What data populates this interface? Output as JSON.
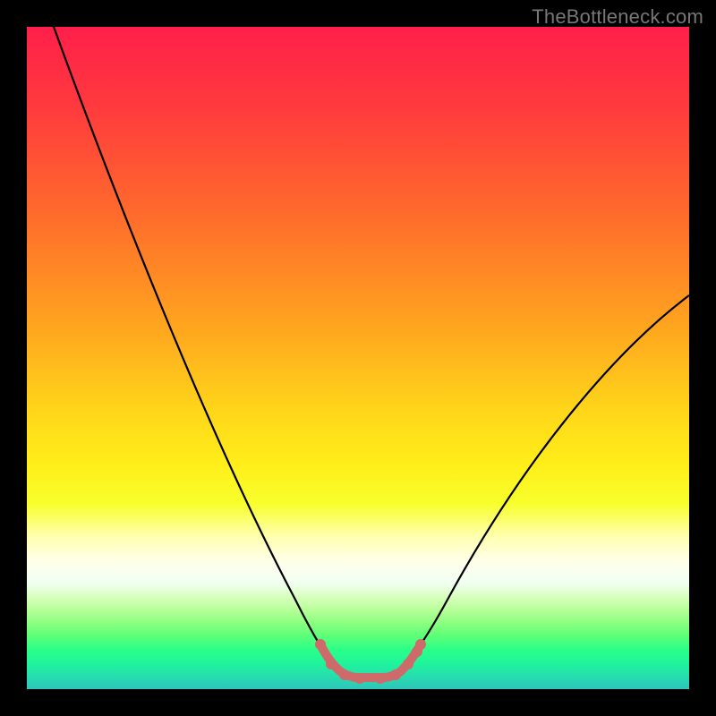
{
  "watermark": "TheBottleneck.com",
  "chart_data": {
    "type": "line",
    "title": "",
    "xlabel": "",
    "ylabel": "",
    "xlim": [
      0,
      100
    ],
    "ylim": [
      0,
      100
    ],
    "grid": false,
    "legend": false,
    "series": [
      {
        "name": "bottleneck-curve",
        "x": [
          4,
          10,
          20,
          30,
          38,
          42,
          45,
          47,
          49,
          51,
          53,
          55,
          57,
          60,
          65,
          75,
          90,
          100
        ],
        "y": [
          100,
          82,
          58,
          36,
          20,
          12,
          6,
          3,
          2,
          2,
          2,
          3,
          5,
          10,
          20,
          36,
          52,
          60
        ],
        "color": "#000000"
      },
      {
        "name": "highlight-valley",
        "x": [
          45,
          46,
          47,
          48,
          49,
          50,
          51,
          52,
          53,
          54,
          55,
          56,
          57
        ],
        "y": [
          6,
          4,
          3,
          2.5,
          2,
          2,
          2,
          2,
          2.5,
          3,
          4,
          5,
          6
        ],
        "color": "#d06a6a"
      }
    ],
    "background_gradient": {
      "top": "#ff1f4a",
      "mid": "#ffee1a",
      "bottom": "#2fc5ba"
    }
  }
}
